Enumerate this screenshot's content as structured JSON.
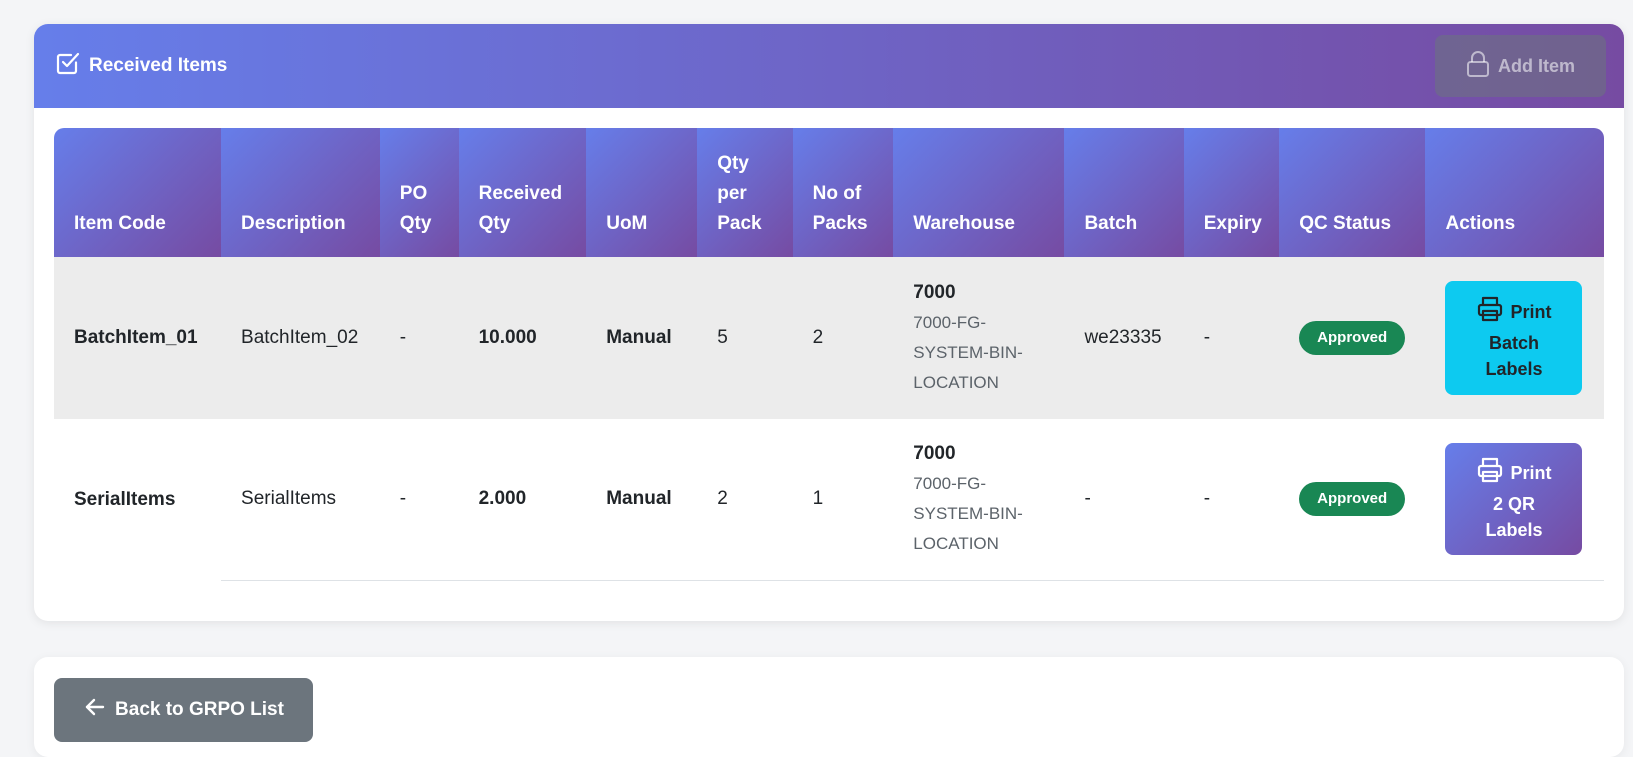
{
  "header": {
    "title": "Received Items",
    "add_button_label": "Add Item"
  },
  "table": {
    "columns": [
      "Item Code",
      "Description",
      "PO Qty",
      "Received Qty",
      "UoM",
      "Qty per Pack",
      "No of Packs",
      "Warehouse",
      "Batch",
      "Expiry",
      "QC Status",
      "Actions"
    ],
    "rows": [
      {
        "item_code": "BatchItem_01",
        "description": "BatchItem_02",
        "po_qty": "-",
        "received_qty": "10.000",
        "uom": "Manual",
        "qty_per_pack": "5",
        "no_of_packs": "2",
        "warehouse_code": "7000",
        "warehouse_location": "7000-FG-SYSTEM-BIN-LOCATION",
        "batch": "we23335",
        "expiry": "-",
        "qc_status": "Approved",
        "action_label_1": "Print",
        "action_label_2": "Batch",
        "action_label_3": "Labels"
      },
      {
        "item_code": "SerialItems",
        "description": "SerialItems",
        "po_qty": "-",
        "received_qty": "2.000",
        "uom": "Manual",
        "qty_per_pack": "2",
        "no_of_packs": "1",
        "warehouse_code": "7000",
        "warehouse_location": "7000-FG-SYSTEM-BIN-LOCATION",
        "batch": "-",
        "expiry": "-",
        "qc_status": "Approved",
        "action_label_1": "Print",
        "action_label_2": "2 QR",
        "action_label_3": "Labels"
      }
    ]
  },
  "footer": {
    "back_button_label": "Back to GRPO List"
  },
  "colors": {
    "gradient_start": "#667eea",
    "gradient_end": "#764ba2",
    "approved": "#198754",
    "print_batch": "#0dcaf0",
    "back_button": "#6c757d"
  }
}
